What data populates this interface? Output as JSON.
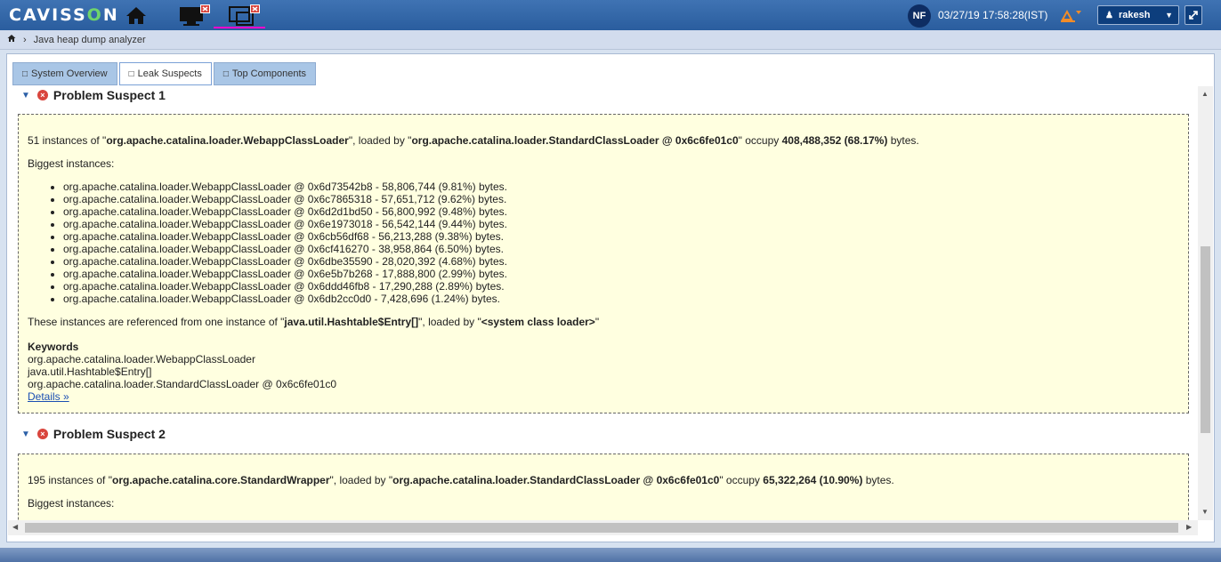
{
  "header": {
    "logo_prefix": "CAVISS",
    "logo_o": "O",
    "logo_suffix": "N",
    "user_initials": "NF",
    "datetime": "03/27/19 17:58:28(IST)",
    "user_name": "rakesh"
  },
  "breadcrumb": {
    "current": "Java heap dump analyzer"
  },
  "tabs": [
    {
      "label": "System Overview",
      "active": false
    },
    {
      "label": "Leak Suspects",
      "active": true
    },
    {
      "label": "Top Components",
      "active": false
    }
  ],
  "suspect1": {
    "title": "Problem Suspect 1",
    "summary_count": "51 instances of \"",
    "summary_class": "org.apache.catalina.loader.WebappClassLoader",
    "summary_loaded_by": "\", loaded by \"",
    "summary_loader": "org.apache.catalina.loader.StandardClassLoader @ 0x6c6fe01c0",
    "summary_occupy": "\" occupy ",
    "summary_bytes": "408,488,352 (68.17%)",
    "summary_suffix": " bytes.",
    "biggest_label": "Biggest instances:",
    "instances": [
      "org.apache.catalina.loader.WebappClassLoader @ 0x6d73542b8 - 58,806,744 (9.81%) bytes.",
      "org.apache.catalina.loader.WebappClassLoader @ 0x6c7865318 - 57,651,712 (9.62%) bytes.",
      "org.apache.catalina.loader.WebappClassLoader @ 0x6d2d1bd50 - 56,800,992 (9.48%) bytes.",
      "org.apache.catalina.loader.WebappClassLoader @ 0x6e1973018 - 56,542,144 (9.44%) bytes.",
      "org.apache.catalina.loader.WebappClassLoader @ 0x6cb56df68 - 56,213,288 (9.38%) bytes.",
      "org.apache.catalina.loader.WebappClassLoader @ 0x6cf416270 - 38,958,864 (6.50%) bytes.",
      "org.apache.catalina.loader.WebappClassLoader @ 0x6dbe35590 - 28,020,392 (4.68%) bytes.",
      "org.apache.catalina.loader.WebappClassLoader @ 0x6e5b7b268 - 17,888,800 (2.99%) bytes.",
      "org.apache.catalina.loader.WebappClassLoader @ 0x6ddd46fb8 - 17,290,288 (2.89%) bytes.",
      "org.apache.catalina.loader.WebappClassLoader @ 0x6db2cc0d0 - 7,428,696 (1.24%) bytes."
    ],
    "ref_prefix": "These instances are referenced from one instance of \"",
    "ref_class": "java.util.Hashtable$Entry[]",
    "ref_mid": "\", loaded by \"",
    "ref_loader": "<system class loader>",
    "ref_suffix": "\"",
    "keywords_label": "Keywords",
    "keywords": [
      "org.apache.catalina.loader.WebappClassLoader",
      "java.util.Hashtable$Entry[]",
      "org.apache.catalina.loader.StandardClassLoader @ 0x6c6fe01c0"
    ],
    "details_link": "Details »"
  },
  "suspect2": {
    "title": "Problem Suspect 2",
    "summary_count": "195 instances of \"",
    "summary_class": "org.apache.catalina.core.StandardWrapper",
    "summary_loaded_by": "\", loaded by \"",
    "summary_loader": "org.apache.catalina.loader.StandardClassLoader @ 0x6c6fe01c0",
    "summary_occupy": "\" occupy ",
    "summary_bytes": "65,322,264 (10.90%)",
    "summary_suffix": " bytes.",
    "biggest_label": "Biggest instances:"
  }
}
